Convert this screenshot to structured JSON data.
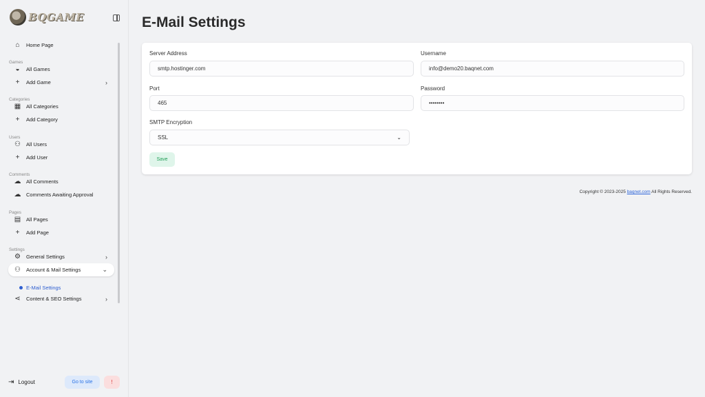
{
  "brand": {
    "name": "BQGAME",
    "logo_icon": "bear-logo-icon"
  },
  "sidebar": {
    "collapse_icon": "sidebar-toggle-icon",
    "items": [
      {
        "type": "item",
        "label": "Home Page",
        "icon": "home-icon"
      },
      {
        "type": "section",
        "label": "Games"
      },
      {
        "type": "item",
        "label": "All Games",
        "icon": "gamepad-icon"
      },
      {
        "type": "item",
        "label": "Add Game",
        "icon": "plus-icon",
        "chevron": "right"
      },
      {
        "type": "section",
        "label": "Categories"
      },
      {
        "type": "item",
        "label": "All Categories",
        "icon": "grid-icon"
      },
      {
        "type": "item",
        "label": "Add Category",
        "icon": "plus-icon"
      },
      {
        "type": "section",
        "label": "Users"
      },
      {
        "type": "item",
        "label": "All Users",
        "icon": "users-icon"
      },
      {
        "type": "item",
        "label": "Add User",
        "icon": "plus-icon"
      },
      {
        "type": "section",
        "label": "Comments"
      },
      {
        "type": "item",
        "label": "All Comments",
        "icon": "comments-icon"
      },
      {
        "type": "item",
        "label": "Comments Awaiting Approval",
        "icon": "comment-dots-icon"
      },
      {
        "type": "section",
        "label": "Pages"
      },
      {
        "type": "item",
        "label": "All Pages",
        "icon": "file-icon"
      },
      {
        "type": "item",
        "label": "Add Page",
        "icon": "plus-icon"
      },
      {
        "type": "section",
        "label": "Settings"
      },
      {
        "type": "item",
        "label": "General Settings",
        "icon": "gear-icon",
        "chevron": "right"
      },
      {
        "type": "item",
        "label": "Account & Mail Settings",
        "icon": "users-gear-icon",
        "chevron": "down",
        "active": true
      },
      {
        "type": "sub",
        "label": "E-Mail Settings"
      },
      {
        "type": "item",
        "label": "Content & SEO Settings",
        "icon": "share-icon",
        "chevron": "right"
      }
    ],
    "logout_label": "Logout",
    "goto_label": "Go to site",
    "alert_label": "!"
  },
  "main": {
    "title": "E-Mail Settings",
    "form": {
      "server_label": "Server Address",
      "server_value": "smtp.hostinger.com",
      "username_label": "Username",
      "username_value": "info@demo20.baqnet.com",
      "port_label": "Port",
      "port_value": "465",
      "password_label": "Password",
      "password_value": "••••••••",
      "encryption_label": "SMTP Encryption",
      "encryption_value": "SSL",
      "save_label": "Save"
    },
    "footer": {
      "prefix": "Copyright © 2023-2025 ",
      "link": "baqnet.com",
      "suffix": " All Rights Reserved."
    }
  },
  "colors": {
    "accent_blue": "#2f5fd0",
    "save_green": "#1f9d55",
    "background": "#f1f2f4"
  }
}
